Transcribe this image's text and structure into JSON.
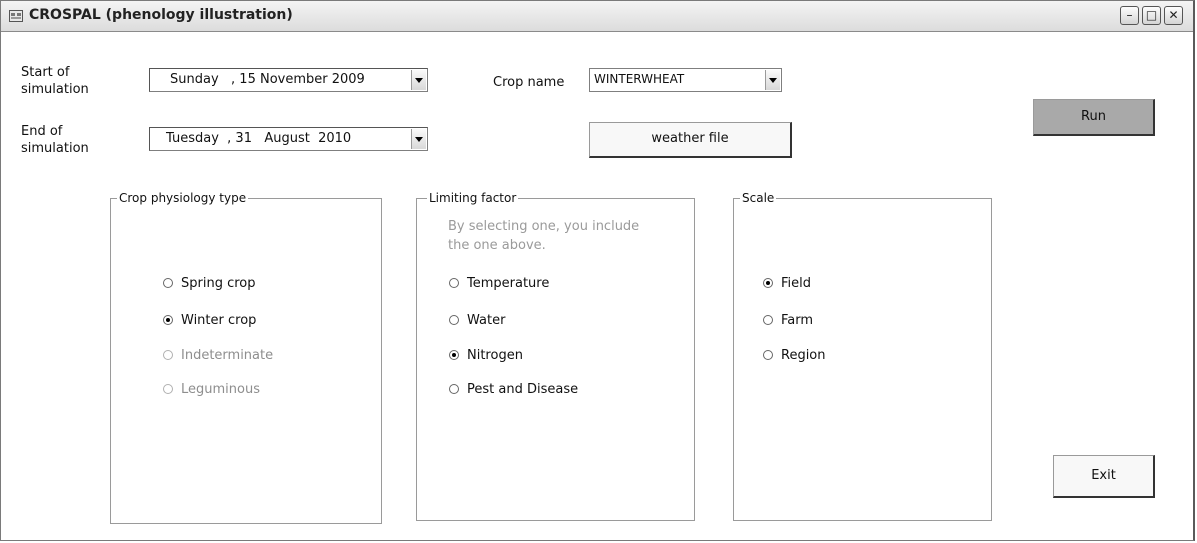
{
  "window": {
    "title": "CROSPAL (phenology illustration)",
    "controls": {
      "minimize": "–",
      "maximize": "□",
      "close": "✕"
    }
  },
  "simulation": {
    "start_label_line1": "Start of",
    "start_label_line2": "simulation",
    "start_date": "Sunday   , 15 November 2009",
    "end_label_line1": "End of",
    "end_label_line2": "simulation",
    "end_date": "Tuesday  , 31   August  2010"
  },
  "crop": {
    "label": "Crop name",
    "selected": "WINTERWHEAT"
  },
  "buttons": {
    "weather_file": "weather file",
    "run": "Run",
    "exit": "Exit"
  },
  "physiology": {
    "title": "Crop physiology type",
    "options": [
      {
        "label": "Spring crop",
        "checked": false,
        "enabled": true
      },
      {
        "label": "Winter crop",
        "checked": true,
        "enabled": true
      },
      {
        "label": "Indeterminate",
        "checked": false,
        "enabled": false
      },
      {
        "label": "Leguminous",
        "checked": false,
        "enabled": false
      }
    ]
  },
  "limiting": {
    "title": "Limiting factor",
    "note_line1": "By selecting one, you include",
    "note_line2": "the one above.",
    "options": [
      {
        "label": "Temperature",
        "checked": false,
        "enabled": true
      },
      {
        "label": "Water",
        "checked": false,
        "enabled": true
      },
      {
        "label": "Nitrogen",
        "checked": true,
        "enabled": true
      },
      {
        "label": "Pest and Disease",
        "checked": false,
        "enabled": true
      }
    ]
  },
  "scale": {
    "title": "Scale",
    "options": [
      {
        "label": "Field",
        "checked": true,
        "enabled": true
      },
      {
        "label": "Farm",
        "checked": false,
        "enabled": true
      },
      {
        "label": "Region",
        "checked": false,
        "enabled": true
      }
    ]
  }
}
